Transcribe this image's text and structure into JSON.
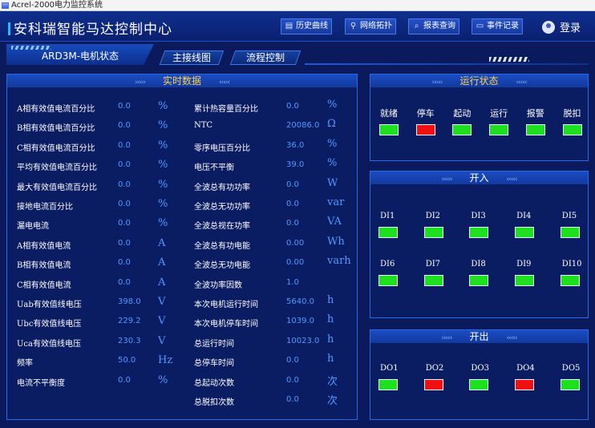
{
  "window_title": "Acrel-2000电力监控系统",
  "app_title": "安科瑞智能马达控制中心",
  "toolbar": [
    {
      "label": "历史曲线",
      "icon": "chart-icon"
    },
    {
      "label": "网络拓扑",
      "icon": "topology-icon"
    },
    {
      "label": "报表查询",
      "icon": "search-icon"
    },
    {
      "label": "事件记录",
      "icon": "document-icon"
    }
  ],
  "login_label": "登录",
  "status_tab": "ARD3M-电机状态",
  "nav_tabs": [
    "主接线图",
    "流程控制"
  ],
  "realtime": {
    "title": "实时数据",
    "left": [
      {
        "label": "A相有效值电流百分比",
        "value": "0.0",
        "unit": "%"
      },
      {
        "label": "B相有效值电流百分比",
        "value": "0.0",
        "unit": "%"
      },
      {
        "label": "C相有效值电流百分比",
        "value": "0.0",
        "unit": "%"
      },
      {
        "label": "平均有效值电流百分比",
        "value": "0.0",
        "unit": "%"
      },
      {
        "label": "最大有效值电流百分比",
        "value": "0.0",
        "unit": "%"
      },
      {
        "label": "接地电流百分比",
        "value": "0.0",
        "unit": "%"
      },
      {
        "label": "漏电电流",
        "value": "0.0",
        "unit": "%"
      },
      {
        "label": "A相有效值电流",
        "value": "0.0",
        "unit": "A"
      },
      {
        "label": "B相有效值电流",
        "value": "0.0",
        "unit": "A"
      },
      {
        "label": "C相有效值电流",
        "value": "0.0",
        "unit": "A"
      },
      {
        "label": "Uab有效值线电压",
        "value": "398.0",
        "unit": "V"
      },
      {
        "label": "Ubc有效值线电压",
        "value": "229.2",
        "unit": "V"
      },
      {
        "label": "Uca有效值线电压",
        "value": "230.3",
        "unit": "V"
      },
      {
        "label": "频率",
        "value": "50.0",
        "unit": "Hz"
      },
      {
        "label": "电流不平衡度",
        "value": "0.0",
        "unit": "%"
      }
    ],
    "right": [
      {
        "label": "累计热容量百分比",
        "value": "0.0",
        "unit": "%"
      },
      {
        "label": "NTC",
        "value": "20086.0",
        "unit": "Ω"
      },
      {
        "label": "零序电压百分比",
        "value": "36.0",
        "unit": "%"
      },
      {
        "label": "电压不平衡",
        "value": "39.0",
        "unit": "%"
      },
      {
        "label": "全波总有功功率",
        "value": "0.0",
        "unit": "W"
      },
      {
        "label": "全波总无功功率",
        "value": "0.0",
        "unit": "var"
      },
      {
        "label": "全波总视在功率",
        "value": "0.0",
        "unit": "VA"
      },
      {
        "label": "全波总有功电能",
        "value": "0.00",
        "unit": "Wh"
      },
      {
        "label": "全波总无功电能",
        "value": "0.00",
        "unit": "varh"
      },
      {
        "label": "全波功率因数",
        "value": "1.0",
        "unit": ""
      },
      {
        "label": "本次电机运行时间",
        "value": "5640.0",
        "unit": "h"
      },
      {
        "label": "本次电机停车时间",
        "value": "1039.0",
        "unit": "h"
      },
      {
        "label": "总运行时间",
        "value": "10023.0",
        "unit": "h"
      },
      {
        "label": "总停车时间",
        "value": "0.0",
        "unit": "h"
      },
      {
        "label": "总起动次数",
        "value": "0.0",
        "unit": "次"
      },
      {
        "label": "总脱扣次数",
        "value": "0.0",
        "unit": "次"
      }
    ]
  },
  "run_status": {
    "title": "运行状态",
    "items": [
      {
        "label": "就绪",
        "color": "#1ee01e"
      },
      {
        "label": "停车",
        "color": "#f01010"
      },
      {
        "label": "起动",
        "color": "#1ee01e"
      },
      {
        "label": "运行",
        "color": "#1ee01e"
      },
      {
        "label": "报警",
        "color": "#1ee01e"
      },
      {
        "label": "脱扣",
        "color": "#1ee01e"
      }
    ]
  },
  "inputs": {
    "title": "开入",
    "items": [
      {
        "label": "DI1",
        "color": "#1ee01e"
      },
      {
        "label": "DI2",
        "color": "#1ee01e"
      },
      {
        "label": "DI3",
        "color": "#1ee01e"
      },
      {
        "label": "DI4",
        "color": "#1ee01e"
      },
      {
        "label": "DI5",
        "color": "#1ee01e"
      },
      {
        "label": "DI6",
        "color": "#1ee01e"
      },
      {
        "label": "DI7",
        "color": "#1ee01e"
      },
      {
        "label": "DI8",
        "color": "#1ee01e"
      },
      {
        "label": "DI9",
        "color": "#1ee01e"
      },
      {
        "label": "DI10",
        "color": "#1ee01e"
      }
    ]
  },
  "outputs": {
    "title": "开出",
    "items": [
      {
        "label": "DO1",
        "color": "#1ee01e"
      },
      {
        "label": "DO2",
        "color": "#f01010"
      },
      {
        "label": "DO3",
        "color": "#1ee01e"
      },
      {
        "label": "DO4",
        "color": "#f01010"
      },
      {
        "label": "DO5",
        "color": "#1ee01e"
      }
    ]
  }
}
